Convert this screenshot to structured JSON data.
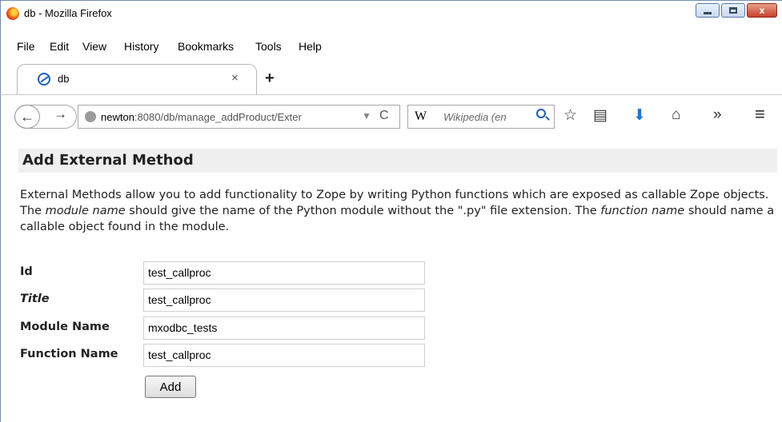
{
  "window": {
    "title": "db - Mozilla Firefox",
    "close_glyph": "x"
  },
  "menu": [
    "File",
    "Edit",
    "View",
    "History",
    "Bookmarks",
    "Tools",
    "Help"
  ],
  "tab": {
    "label": "db",
    "close": "×",
    "new_tab": "+"
  },
  "nav": {
    "url_host": "newton",
    "url_rest": ":8080/db/manage_addProduct/Exter",
    "search_engine": "W",
    "search_placeholder": "Wikipedia (en",
    "bookmark_glyph": "☆",
    "library_glyph": "▤",
    "download_glyph": "⬇",
    "home_glyph": "⌂",
    "overflow_glyph": "»",
    "menu_glyph": "≡",
    "back_glyph": "←",
    "forward_glyph": "→",
    "reload_glyph": "C",
    "drop_glyph": "▼"
  },
  "page": {
    "heading": "Add External Method",
    "desc": {
      "p1": "External Methods allow you to add functionality to Zope by writing Python functions which are exposed as callable Zope objects. The ",
      "em1": "module name",
      "p2": " should give the name of the Python module without the \".py\" file extension. The ",
      "em2": "function name",
      "p3": " should name a callable object found in the module."
    },
    "form": {
      "id_label": "Id",
      "id_value": "test_callproc",
      "title_label": "Title",
      "title_value": "test_callproc",
      "module_label": "Module Name",
      "module_value": "mxodbc_tests",
      "function_label": "Function Name",
      "function_value": "test_callproc",
      "submit_label": "Add"
    }
  }
}
